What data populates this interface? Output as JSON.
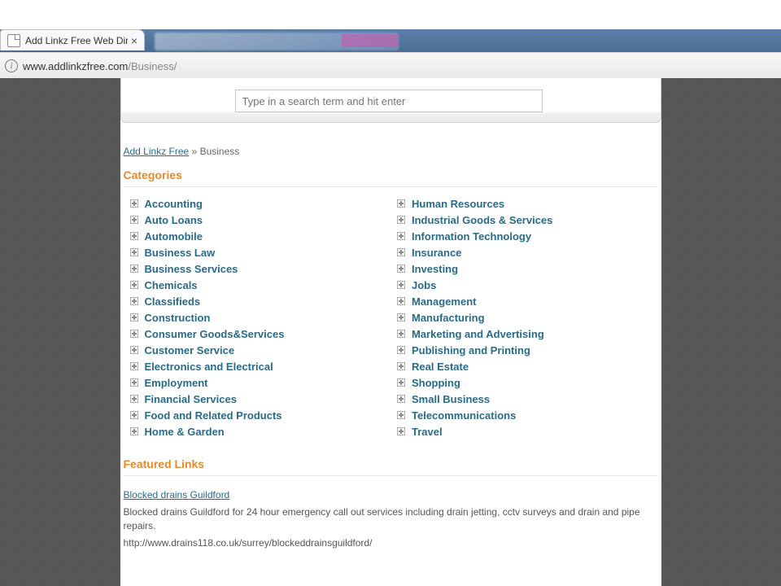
{
  "browser": {
    "tab_title": "Add Linkz Free Web Dire",
    "url_host": "www.addlinkzfree.com",
    "url_path": "/Business/",
    "info_glyph": "i"
  },
  "search": {
    "placeholder": "Type in a search term and hit enter"
  },
  "breadcrumb": {
    "root": "Add Linkz Free",
    "sep": " » ",
    "current": "Business"
  },
  "sections": {
    "categories": "Categories",
    "featured": "Featured Links"
  },
  "categories_col1": [
    "Accounting",
    "Auto Loans",
    "Automobile",
    "Business Law",
    "Business Services",
    "Chemicals",
    "Classifieds",
    "Construction",
    "Consumer Goods&Services",
    "Customer Service",
    "Electronics and Electrical",
    "Employment",
    "Financial Services",
    "Food and Related Products",
    "Home & Garden"
  ],
  "categories_col2": [
    "Human Resources",
    "Industrial Goods & Services",
    "Information Technology",
    "Insurance",
    "Investing",
    "Jobs",
    "Management",
    "Manufacturing",
    "Marketing and Advertising",
    "Publishing and Printing",
    "Real Estate",
    "Shopping",
    "Small Business",
    "Telecommunications",
    "Travel"
  ],
  "featured": {
    "title": "Blocked drains Guildford",
    "desc": "Blocked drains Guildford for 24 hour emergency call out services including drain jetting, cctv surveys and drain and pipe repairs.",
    "url": "http://www.drains118.co.uk/surrey/blockeddrainsguildford/"
  }
}
